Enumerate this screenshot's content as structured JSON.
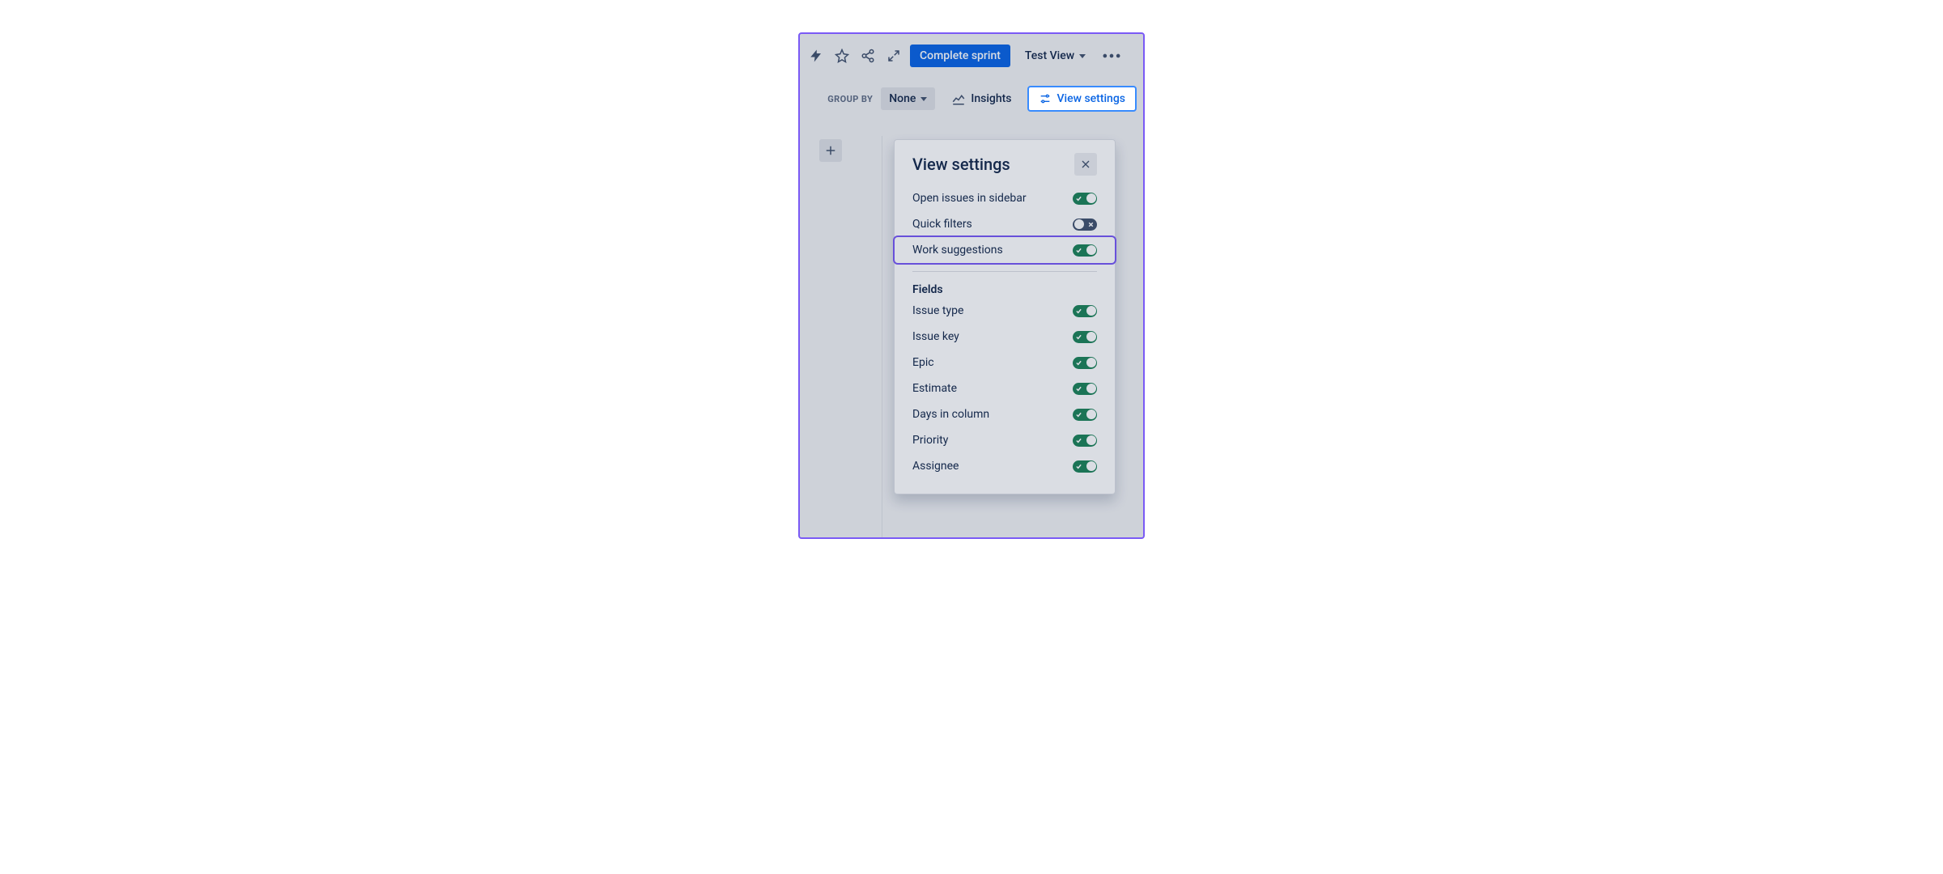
{
  "toolbar": {
    "complete_sprint_label": "Complete sprint",
    "test_view_label": "Test View"
  },
  "subbar": {
    "group_by_label": "GROUP BY",
    "none_label": "None",
    "insights_label": "Insights",
    "view_settings_label": "View settings"
  },
  "panel": {
    "title": "View settings",
    "rows": [
      {
        "label": "Open issues in sidebar",
        "on": true,
        "highlighted": false
      },
      {
        "label": "Quick filters",
        "on": false,
        "highlighted": false
      },
      {
        "label": "Work suggestions",
        "on": true,
        "highlighted": true
      }
    ],
    "fields_label": "Fields",
    "fields": [
      {
        "label": "Issue type",
        "on": true
      },
      {
        "label": "Issue key",
        "on": true
      },
      {
        "label": "Epic",
        "on": true
      },
      {
        "label": "Estimate",
        "on": true
      },
      {
        "label": "Days in column",
        "on": true
      },
      {
        "label": "Priority",
        "on": true
      },
      {
        "label": "Assignee",
        "on": true
      }
    ]
  }
}
